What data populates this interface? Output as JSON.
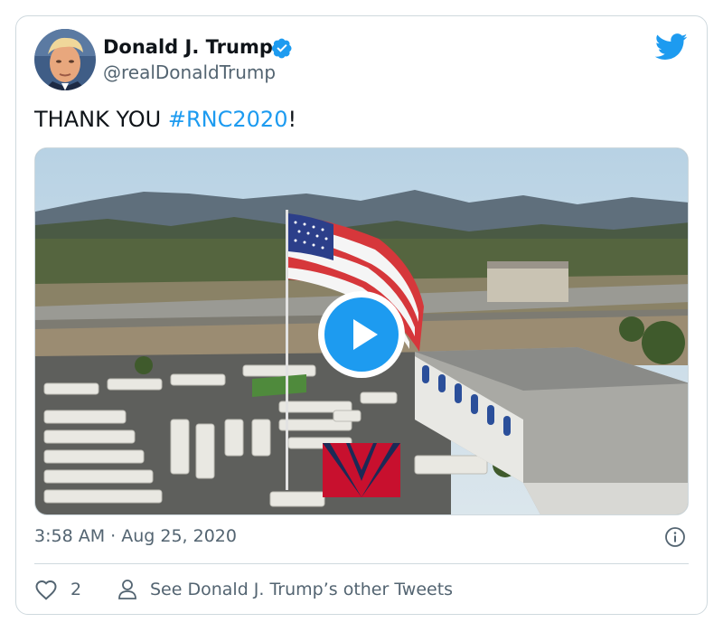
{
  "author": {
    "display_name": "Donald J. Trump",
    "handle": "@realDonaldTrump",
    "verified": true,
    "avatar_icon": "profile-photo"
  },
  "tweet": {
    "text_prefix": "THANK YOU ",
    "hashtag": "#RNC2020",
    "text_suffix": "!"
  },
  "media": {
    "type": "video",
    "description_icon": "play-icon"
  },
  "meta": {
    "timestamp": "3:58 AM · Aug 25, 2020"
  },
  "actions": {
    "like_count": "2",
    "other_tweets_label": "See Donald J. Trump’s other Tweets"
  },
  "colors": {
    "brand_blue": "#1d9bf0",
    "secondary_text": "#536471",
    "border": "#cfd9de"
  }
}
